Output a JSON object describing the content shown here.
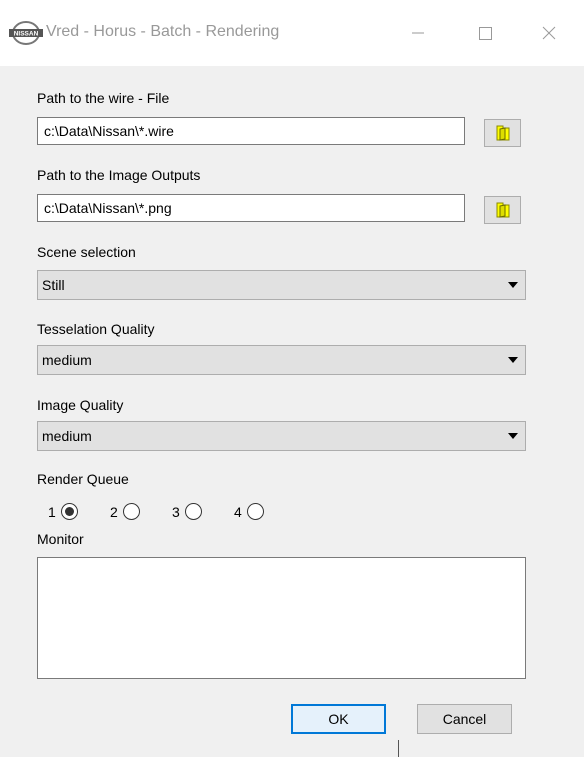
{
  "window": {
    "title": "Vred - Horus - Batch - Rendering",
    "logo_text": "NISSAN",
    "icon_min": "minimize-icon",
    "icon_max": "maximize-icon",
    "icon_close": "close-icon"
  },
  "form": {
    "wire_label": "Path to the wire - File",
    "wire_value": "c:\\Data\\Nissan\\*.wire",
    "output_label": "Path to the Image Outputs",
    "output_value": "c:\\Data\\Nissan\\*.png",
    "folder_icon": "folder-icon",
    "folder_color": "#ffff00",
    "scene_label": "Scene selection",
    "scene_value": "Still",
    "tess_label": "Tesselation Quality",
    "tess_value": "medium",
    "image_label": "Image Quality",
    "image_value": "medium",
    "queue_label": "Render Queue",
    "queue_options": [
      "1",
      "2",
      "3",
      "4"
    ],
    "queue_selected": "1",
    "monitor_label": "Monitor",
    "monitor_text": ""
  },
  "buttons": {
    "ok": "OK",
    "cancel": "Cancel"
  },
  "colors": {
    "accent": "#0078d7"
  }
}
